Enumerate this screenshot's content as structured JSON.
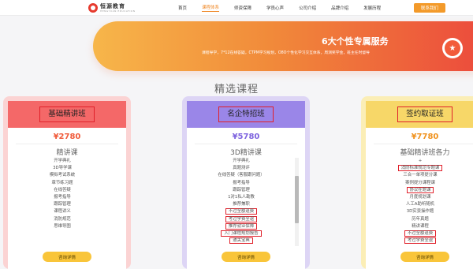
{
  "brand": {
    "name_cn": "恒源教育",
    "name_en": "HENGYUAN EDUCATION",
    "logo_icon": "circle-logo-icon"
  },
  "nav": {
    "links": [
      "首页",
      "课程体系",
      "师资保障",
      "学员心声",
      "公司介绍",
      "品牌介绍",
      "发展历程"
    ],
    "active_index": 1,
    "cta": "联系我们"
  },
  "banner": {
    "title": "6大个性专属服务",
    "subtitle": "课程导学，7*12在线答疑，CTPM学习规划，O8O个性化学习交互体系，周测奖学金，班主任时督导",
    "badge_icon": "star-medal-icon"
  },
  "section_title": "精选课程",
  "cards": [
    {
      "name": "基础精讲班",
      "price": "¥2780",
      "type": "精讲课",
      "items": [
        {
          "text": "开学典礼",
          "hl": false
        },
        {
          "text": "3D导学课",
          "hl": false
        },
        {
          "text": "模拟考试系统",
          "hl": false
        },
        {
          "text": "章节练习题",
          "hl": false
        },
        {
          "text": "在线答疑",
          "hl": false
        },
        {
          "text": "报考指导",
          "hl": false
        },
        {
          "text": "跟踪管理",
          "hl": false
        },
        {
          "text": "课程讲义",
          "hl": false
        },
        {
          "text": "消防规范",
          "hl": false
        },
        {
          "text": "思维导图",
          "hl": false
        }
      ],
      "consult": "咨询详情",
      "colors": {
        "outer": "#fbd3d3",
        "header": "#f46868",
        "price": "#f05a3a"
      }
    },
    {
      "name": "名企特招班",
      "price": "¥5780",
      "type": "3D精讲课",
      "items": [
        {
          "text": "开学典礼",
          "hl": false
        },
        {
          "text": "真题测评",
          "hl": false
        },
        {
          "text": "在线答疑（客服跟问题）",
          "hl": false
        },
        {
          "text": "报考指导",
          "hl": false
        },
        {
          "text": "跟踪管理",
          "hl": false
        },
        {
          "text": "1对1私人勘教",
          "hl": false
        },
        {
          "text": "推荐兼职",
          "hl": false
        },
        {
          "text": "不过全额退费",
          "hl": true
        },
        {
          "text": "考过学费全退",
          "hl": true
        },
        {
          "text": "推荐就业保障",
          "hl": true
        },
        {
          "text": "入门课程规划报告",
          "hl": true
        },
        {
          "text": "通关宝典",
          "hl": true
        }
      ],
      "scroll_fraction": 0.45,
      "consult": "咨询详情",
      "colors": {
        "outer": "#ddd5f5",
        "header": "#9a86e8",
        "price": "#7d63df"
      }
    },
    {
      "name": "签约取证班",
      "price": "¥7780",
      "type": "基础精讲班各力",
      "items": [
        {
          "text": "+",
          "hl": false
        },
        {
          "text": "消防标准规范专题课",
          "hl": true
        },
        {
          "text": "三合一单项提分课",
          "hl": false
        },
        {
          "text": "案例提分课程课",
          "hl": false
        },
        {
          "text": "协议在题课",
          "hl": true
        },
        {
          "text": "月度规划课",
          "hl": false
        },
        {
          "text": "人工A助听随机",
          "hl": false
        },
        {
          "text": "3D实景操作题",
          "hl": false
        },
        {
          "text": "历年真题",
          "hl": false
        },
        {
          "text": "精讲课程",
          "hl": false
        },
        {
          "text": "不过全额退费",
          "hl": true
        },
        {
          "text": "考过学费全退",
          "hl": true
        }
      ],
      "scroll_fraction": 0.5,
      "consult": "咨询详情",
      "colors": {
        "outer": "#fbeeb6",
        "header": "#f7d768",
        "price": "#f0921e"
      }
    }
  ]
}
